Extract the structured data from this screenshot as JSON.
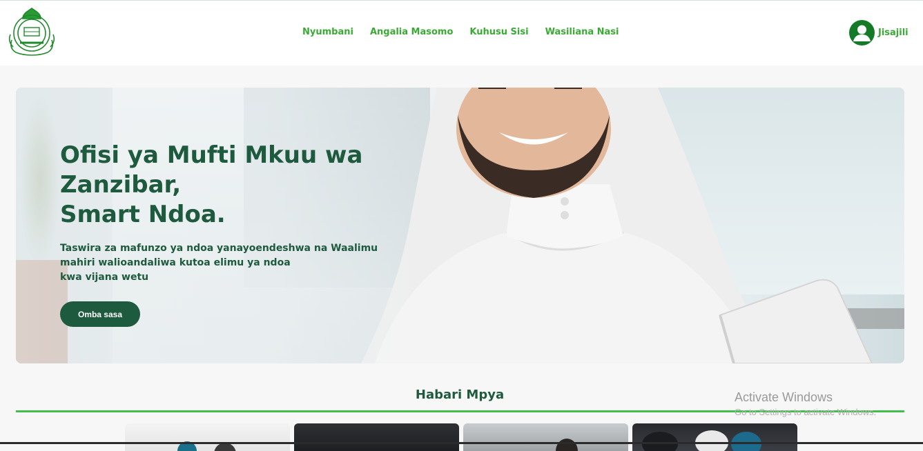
{
  "logo": {
    "alt": "Ofisi ya Mufti Mkuu wa Zanzibar logo"
  },
  "nav": {
    "items": [
      {
        "label": "Nyumbani"
      },
      {
        "label": "Angalia Masomo"
      },
      {
        "label": "Kuhusu Sisi"
      },
      {
        "label": "Wasiliana Nasi"
      }
    ]
  },
  "account": {
    "signup_label": "Jisajili"
  },
  "hero": {
    "title_lines": [
      "Ofisi ya Mufti Mkuu wa",
      "Zanzibar,",
      "Smart Ndoa."
    ],
    "subtitle_lines": [
      "Taswira za mafunzo ya ndoa yanayoendeshwa na Waalimu",
      "mahiri walioandaliwa kutoa elimu ya ndoa",
      "kwa vijana wetu"
    ],
    "cta_label": "Omba sasa"
  },
  "news": {
    "heading": "Habari Mpya"
  },
  "os_watermark": {
    "line1": "Activate Windows",
    "line2": "Go to Settings to activate Windows."
  },
  "colors": {
    "brand_green": "#3aaa35",
    "dark_green": "#1d5a3e",
    "accent_line": "#3fbf4a"
  }
}
